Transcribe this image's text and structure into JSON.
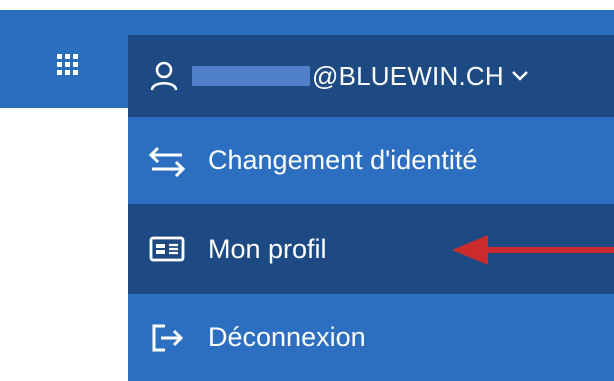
{
  "header": {
    "apps_icon": "grid-icon",
    "account": {
      "user_icon": "user-icon",
      "email_visible": "@BLUEWIN.CH",
      "dropdown_icon": "chevron-down-icon"
    }
  },
  "menu": {
    "items": [
      {
        "label": "Changement d'identité",
        "icon": "switch-arrows-icon"
      },
      {
        "label": "Mon profil",
        "icon": "id-card-icon",
        "active": true
      },
      {
        "label": "Déconnexion",
        "icon": "logout-icon"
      }
    ]
  },
  "annotation": {
    "arrow_color": "#cc2b2b"
  },
  "colors": {
    "topbar": "#2a6fbe",
    "account_bg": "#1e4a84",
    "menu_bg": "#2c6fc1",
    "active_bg": "#1e4a84",
    "text": "#ffffff"
  }
}
